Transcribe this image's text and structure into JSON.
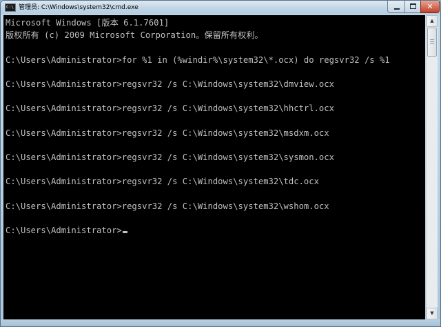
{
  "window": {
    "title": "管理员: C:\\Windows\\system32\\cmd.exe",
    "app_icon_glyph": "C:\\"
  },
  "controls": {
    "minimize_icon": "minimize-icon",
    "maximize_icon": "maximize-icon",
    "close_glyph": "✕"
  },
  "console": {
    "lines": [
      "Microsoft Windows [版本 6.1.7601]",
      "版权所有 (c) 2009 Microsoft Corporation。保留所有权利。",
      "",
      "C:\\Users\\Administrator>for %1 in (%windir%\\system32\\*.ocx) do regsvr32 /s %1",
      "",
      "C:\\Users\\Administrator>regsvr32 /s C:\\Windows\\system32\\dmview.ocx",
      "",
      "C:\\Users\\Administrator>regsvr32 /s C:\\Windows\\system32\\hhctrl.ocx",
      "",
      "C:\\Users\\Administrator>regsvr32 /s C:\\Windows\\system32\\msdxm.ocx",
      "",
      "C:\\Users\\Administrator>regsvr32 /s C:\\Windows\\system32\\sysmon.ocx",
      "",
      "C:\\Users\\Administrator>regsvr32 /s C:\\Windows\\system32\\tdc.ocx",
      "",
      "C:\\Users\\Administrator>regsvr32 /s C:\\Windows\\system32\\wshom.ocx",
      "",
      "C:\\Users\\Administrator>"
    ],
    "text_color": "#c0c0c0",
    "background": "#000000"
  },
  "scrollbar": {
    "up_glyph": "▲",
    "down_glyph": "▼",
    "position": 0
  }
}
